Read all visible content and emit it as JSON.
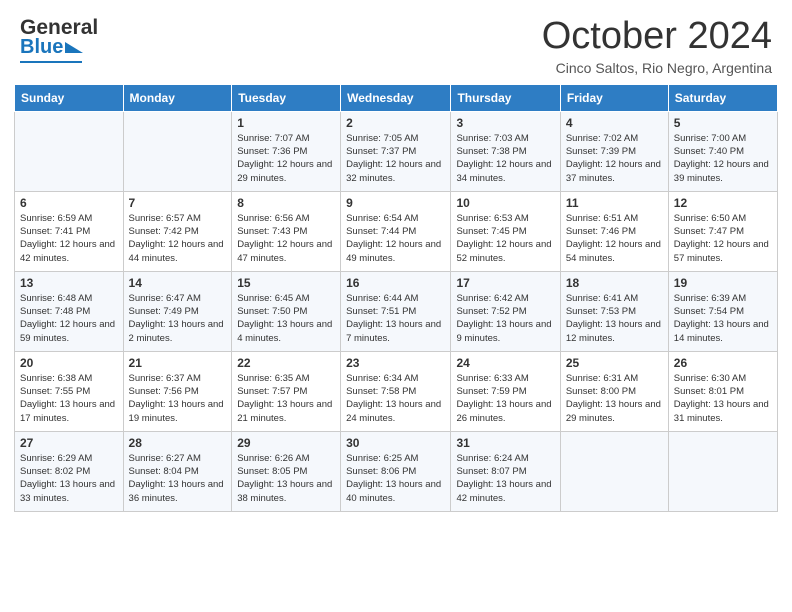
{
  "header": {
    "logo_general": "General",
    "logo_blue": "Blue",
    "month": "October 2024",
    "location": "Cinco Saltos, Rio Negro, Argentina"
  },
  "calendar": {
    "days_of_week": [
      "Sunday",
      "Monday",
      "Tuesday",
      "Wednesday",
      "Thursday",
      "Friday",
      "Saturday"
    ],
    "weeks": [
      [
        {
          "day": "",
          "info": ""
        },
        {
          "day": "",
          "info": ""
        },
        {
          "day": "1",
          "info": "Sunrise: 7:07 AM\nSunset: 7:36 PM\nDaylight: 12 hours and 29 minutes."
        },
        {
          "day": "2",
          "info": "Sunrise: 7:05 AM\nSunset: 7:37 PM\nDaylight: 12 hours and 32 minutes."
        },
        {
          "day": "3",
          "info": "Sunrise: 7:03 AM\nSunset: 7:38 PM\nDaylight: 12 hours and 34 minutes."
        },
        {
          "day": "4",
          "info": "Sunrise: 7:02 AM\nSunset: 7:39 PM\nDaylight: 12 hours and 37 minutes."
        },
        {
          "day": "5",
          "info": "Sunrise: 7:00 AM\nSunset: 7:40 PM\nDaylight: 12 hours and 39 minutes."
        }
      ],
      [
        {
          "day": "6",
          "info": "Sunrise: 6:59 AM\nSunset: 7:41 PM\nDaylight: 12 hours and 42 minutes."
        },
        {
          "day": "7",
          "info": "Sunrise: 6:57 AM\nSunset: 7:42 PM\nDaylight: 12 hours and 44 minutes."
        },
        {
          "day": "8",
          "info": "Sunrise: 6:56 AM\nSunset: 7:43 PM\nDaylight: 12 hours and 47 minutes."
        },
        {
          "day": "9",
          "info": "Sunrise: 6:54 AM\nSunset: 7:44 PM\nDaylight: 12 hours and 49 minutes."
        },
        {
          "day": "10",
          "info": "Sunrise: 6:53 AM\nSunset: 7:45 PM\nDaylight: 12 hours and 52 minutes."
        },
        {
          "day": "11",
          "info": "Sunrise: 6:51 AM\nSunset: 7:46 PM\nDaylight: 12 hours and 54 minutes."
        },
        {
          "day": "12",
          "info": "Sunrise: 6:50 AM\nSunset: 7:47 PM\nDaylight: 12 hours and 57 minutes."
        }
      ],
      [
        {
          "day": "13",
          "info": "Sunrise: 6:48 AM\nSunset: 7:48 PM\nDaylight: 12 hours and 59 minutes."
        },
        {
          "day": "14",
          "info": "Sunrise: 6:47 AM\nSunset: 7:49 PM\nDaylight: 13 hours and 2 minutes."
        },
        {
          "day": "15",
          "info": "Sunrise: 6:45 AM\nSunset: 7:50 PM\nDaylight: 13 hours and 4 minutes."
        },
        {
          "day": "16",
          "info": "Sunrise: 6:44 AM\nSunset: 7:51 PM\nDaylight: 13 hours and 7 minutes."
        },
        {
          "day": "17",
          "info": "Sunrise: 6:42 AM\nSunset: 7:52 PM\nDaylight: 13 hours and 9 minutes."
        },
        {
          "day": "18",
          "info": "Sunrise: 6:41 AM\nSunset: 7:53 PM\nDaylight: 13 hours and 12 minutes."
        },
        {
          "day": "19",
          "info": "Sunrise: 6:39 AM\nSunset: 7:54 PM\nDaylight: 13 hours and 14 minutes."
        }
      ],
      [
        {
          "day": "20",
          "info": "Sunrise: 6:38 AM\nSunset: 7:55 PM\nDaylight: 13 hours and 17 minutes."
        },
        {
          "day": "21",
          "info": "Sunrise: 6:37 AM\nSunset: 7:56 PM\nDaylight: 13 hours and 19 minutes."
        },
        {
          "day": "22",
          "info": "Sunrise: 6:35 AM\nSunset: 7:57 PM\nDaylight: 13 hours and 21 minutes."
        },
        {
          "day": "23",
          "info": "Sunrise: 6:34 AM\nSunset: 7:58 PM\nDaylight: 13 hours and 24 minutes."
        },
        {
          "day": "24",
          "info": "Sunrise: 6:33 AM\nSunset: 7:59 PM\nDaylight: 13 hours and 26 minutes."
        },
        {
          "day": "25",
          "info": "Sunrise: 6:31 AM\nSunset: 8:00 PM\nDaylight: 13 hours and 29 minutes."
        },
        {
          "day": "26",
          "info": "Sunrise: 6:30 AM\nSunset: 8:01 PM\nDaylight: 13 hours and 31 minutes."
        }
      ],
      [
        {
          "day": "27",
          "info": "Sunrise: 6:29 AM\nSunset: 8:02 PM\nDaylight: 13 hours and 33 minutes."
        },
        {
          "day": "28",
          "info": "Sunrise: 6:27 AM\nSunset: 8:04 PM\nDaylight: 13 hours and 36 minutes."
        },
        {
          "day": "29",
          "info": "Sunrise: 6:26 AM\nSunset: 8:05 PM\nDaylight: 13 hours and 38 minutes."
        },
        {
          "day": "30",
          "info": "Sunrise: 6:25 AM\nSunset: 8:06 PM\nDaylight: 13 hours and 40 minutes."
        },
        {
          "day": "31",
          "info": "Sunrise: 6:24 AM\nSunset: 8:07 PM\nDaylight: 13 hours and 42 minutes."
        },
        {
          "day": "",
          "info": ""
        },
        {
          "day": "",
          "info": ""
        }
      ]
    ]
  }
}
